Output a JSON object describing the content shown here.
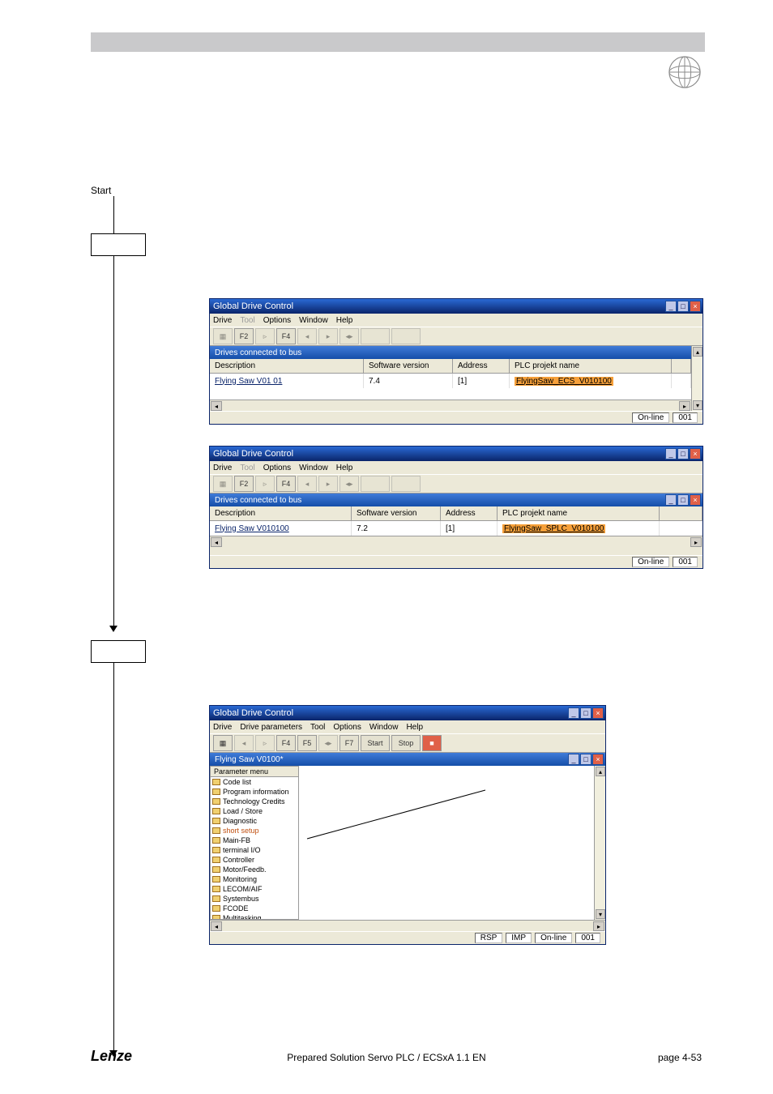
{
  "start_label": "Start",
  "globe_icon": "globe-icon",
  "windows": {
    "w1": {
      "title": "Global Drive Control",
      "menu": [
        "Drive",
        "Tool",
        "Options",
        "Window",
        "Help"
      ],
      "menu_disabled_idx": 1,
      "section_header": "Drives connected to bus",
      "columns": [
        "Description",
        "Software version",
        "Address",
        "PLC projekt name"
      ],
      "row": {
        "desc": "Flying Saw V01 01",
        "sw": "7.4",
        "addr": "[1]",
        "plc": "FlyingSaw_ECS_V010100"
      },
      "status": [
        "On-line",
        "001"
      ]
    },
    "w2": {
      "title": "Global Drive Control",
      "menu": [
        "Drive",
        "Tool",
        "Options",
        "Window",
        "Help"
      ],
      "menu_disabled_idx": 1,
      "section_header": "Drives connected to bus",
      "columns": [
        "Description",
        "Software version",
        "Address",
        "PLC projekt name"
      ],
      "row": {
        "desc": "Flying Saw V010100",
        "sw": "7.2",
        "addr": "[1]",
        "plc": "FlyingSaw_SPLC_V010100"
      },
      "status": [
        "On-line",
        "001"
      ]
    },
    "w3": {
      "title": "Global Drive Control",
      "menu": [
        "Drive",
        "Drive parameters",
        "Tool",
        "Options",
        "Window",
        "Help"
      ],
      "toolbar_text": [
        "Start",
        "Stop"
      ],
      "sub_title": "Flying Saw V0100*",
      "tree_header": "Parameter menu",
      "tree": [
        "Code list",
        "Program information",
        "Technology Credits",
        "Load / Store",
        "Diagnostic",
        "short setup",
        "Main-FB",
        "terminal I/O",
        "Controller",
        "Motor/Feedb.",
        "Monitoring",
        "LECOM/AIF",
        "Systembus",
        "FCODE",
        "Multitasking"
      ],
      "tree_highlight_idx": 5,
      "status": [
        "RSP",
        "IMP",
        "On-line",
        "001"
      ]
    }
  },
  "footer": {
    "brand": "Lenze",
    "center": "Prepared Solution Servo PLC / ECSxA 1.1 EN",
    "right": "page 4-53"
  }
}
